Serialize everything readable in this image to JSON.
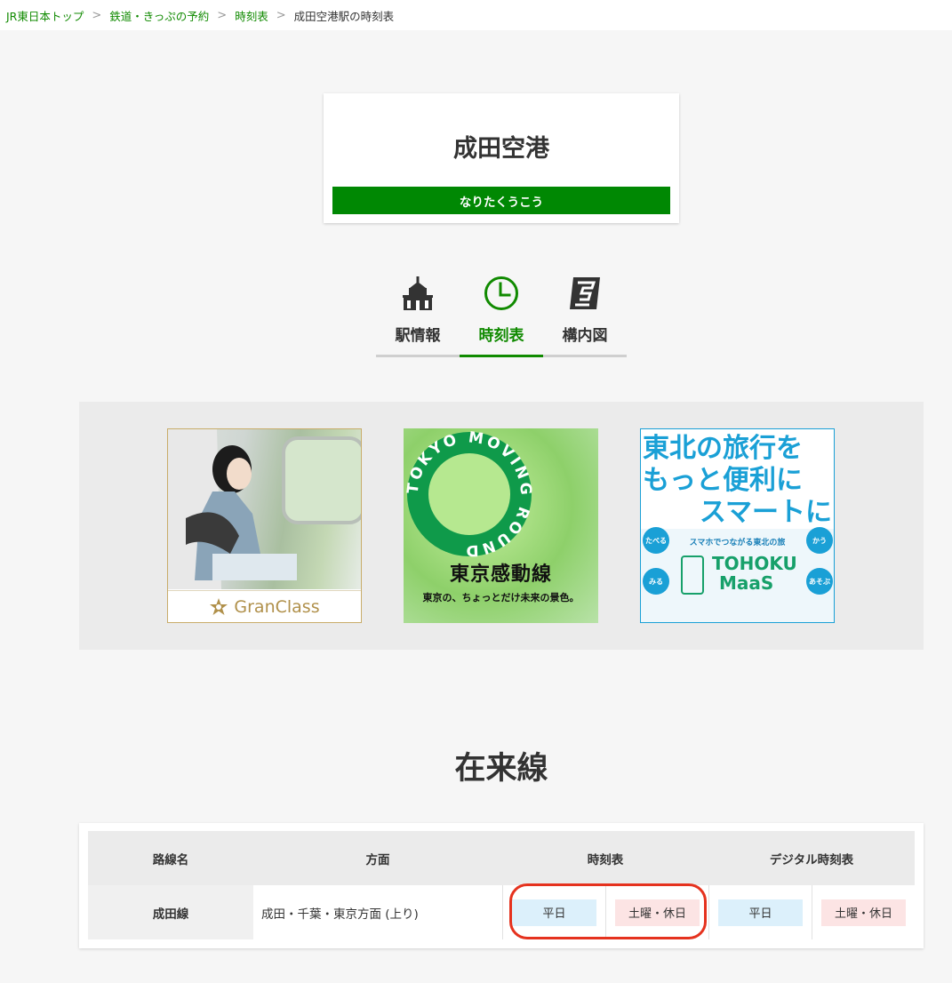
{
  "breadcrumb": {
    "items": [
      "JR東日本トップ",
      "鉄道・きっぷの予約",
      "時刻表"
    ],
    "current": "成田空港駅の時刻表",
    "separator": ">"
  },
  "station": {
    "name": "成田空港",
    "kana": "なりたくうこう"
  },
  "tabs": [
    {
      "label": "駅情報",
      "icon": "station-building-icon",
      "active": false
    },
    {
      "label": "時刻表",
      "icon": "clock-icon",
      "active": true
    },
    {
      "label": "構内図",
      "icon": "floor-map-icon",
      "active": false
    }
  ],
  "banners": {
    "granclass": {
      "logo": "GranClass"
    },
    "tokyo_moving": {
      "ring_text": "TOKYO MOVING ROUND",
      "title": "東京感動線",
      "subtitle": "東京の、ちょっとだけ未来の景色。"
    },
    "tohoku": {
      "lines": [
        "東北の旅行を",
        "もっと便利に",
        "スマートに"
      ],
      "small": "スマホでつながる東北の旅",
      "bubbles": [
        "たべる",
        "かう",
        "みる",
        "あそぶ"
      ],
      "brand1": "TOHOKU",
      "brand2": "MaaS"
    }
  },
  "section": {
    "title": "在来線"
  },
  "table": {
    "headers": [
      "路線名",
      "方面",
      "時刻表",
      "デジタル時刻表"
    ],
    "rows": [
      {
        "line": "成田線",
        "direction": "成田・千葉・東京方面 (上り)",
        "weekday": "平日",
        "holiday": "土曜・休日",
        "digital_weekday": "平日",
        "digital_holiday": "土曜・休日"
      }
    ]
  },
  "colors": {
    "brand_green": "#008803",
    "highlight_red": "#e5321e",
    "weekday_bg": "#dcf0fb",
    "holiday_bg": "#fce4e4"
  }
}
